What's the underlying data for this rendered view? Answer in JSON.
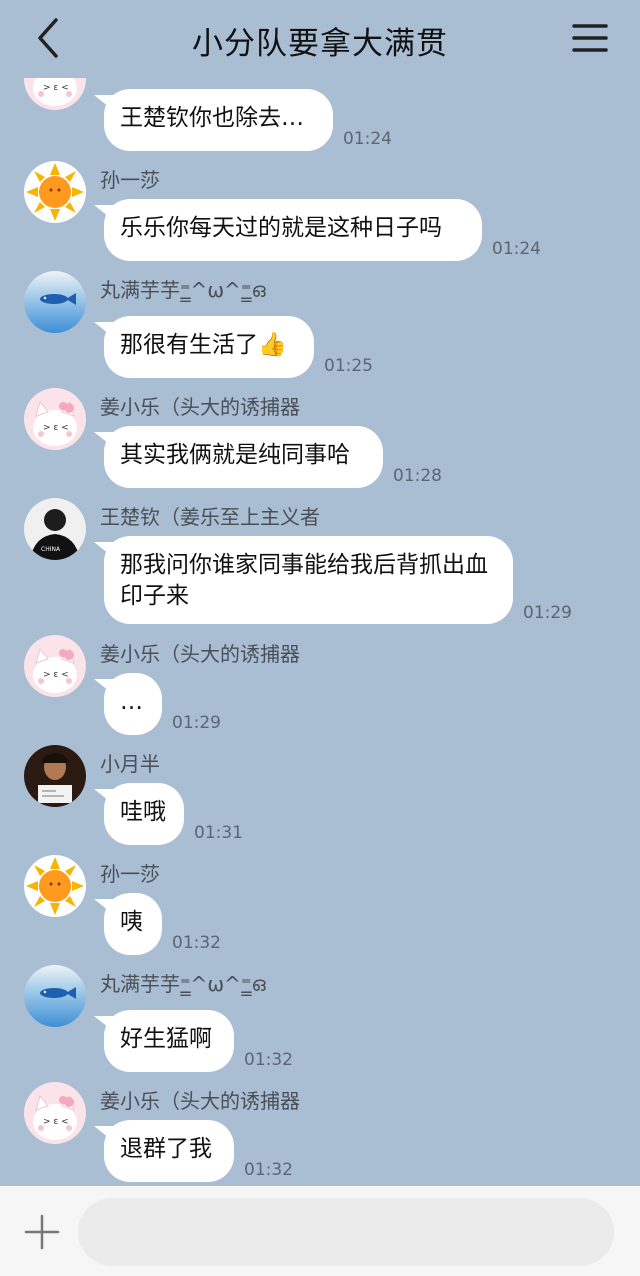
{
  "header": {
    "title": "小分队要拿大满贯",
    "back_icon": "chevron-left-icon",
    "menu_icon": "hamburger-menu-icon"
  },
  "messages": [
    {
      "sender": "",
      "avatar": "kitty-avatar",
      "text": "王楚钦你也除去…",
      "time": "01:24"
    },
    {
      "sender": "孙一莎",
      "avatar": "sun-avatar",
      "text": "乐乐你每天过的就是这种日子吗",
      "time": "01:24"
    },
    {
      "sender": "丸满芋芋⁼̳^ω^⁼̳ഒ",
      "avatar": "fish-avatar",
      "text": "那很有生活了👍",
      "time": "01:25"
    },
    {
      "sender": "姜小乐（头大的诱捕器",
      "avatar": "kitty-avatar",
      "text": "其实我俩就是纯同事哈",
      "time": "01:28"
    },
    {
      "sender": "王楚钦（姜乐至上主义者",
      "avatar": "athlete-avatar",
      "text": "那我问你谁家同事能给我后背抓出血印子来",
      "time": "01:29"
    },
    {
      "sender": "姜小乐（头大的诱捕器",
      "avatar": "kitty-avatar",
      "text": "…",
      "time": "01:29"
    },
    {
      "sender": "小月半",
      "avatar": "portrait-avatar",
      "text": "哇哦",
      "time": "01:31"
    },
    {
      "sender": "孙一莎",
      "avatar": "sun-avatar",
      "text": "咦",
      "time": "01:32"
    },
    {
      "sender": "丸满芋芋⁼̳^ω^⁼̳ഒ",
      "avatar": "fish-avatar",
      "text": "好生猛啊",
      "time": "01:32"
    },
    {
      "sender": "姜小乐（头大的诱捕器",
      "avatar": "kitty-avatar",
      "text": "退群了我",
      "time": "01:32"
    }
  ],
  "composer": {
    "plus_icon": "plus-icon",
    "placeholder": ""
  },
  "colors": {
    "background": "#a9bdd3",
    "bubble": "#ffffff",
    "composer": "#f6f6f6"
  }
}
